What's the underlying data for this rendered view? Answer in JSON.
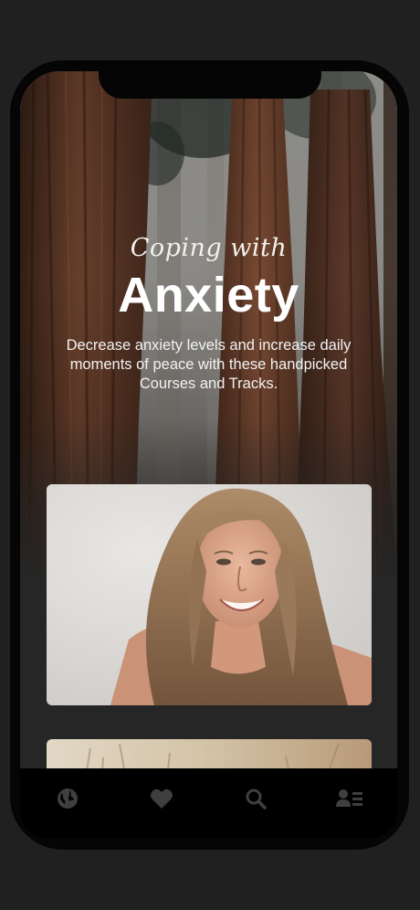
{
  "hero": {
    "eyebrow": "Coping with",
    "title": "Anxiety",
    "description": "Decrease anxiety levels and increase daily moments of peace with these handpicked Courses and Tracks."
  },
  "cards": [
    {
      "image": "portrait-smiling-woman-photo"
    },
    {
      "image": "grass-field-photo"
    }
  ],
  "tabbar": {
    "items": [
      {
        "icon": "globe-icon"
      },
      {
        "icon": "heart-icon"
      },
      {
        "icon": "search-icon"
      },
      {
        "icon": "profile-list-icon"
      }
    ],
    "icon_color": "#3f3f3f"
  },
  "colors": {
    "background": "#202020",
    "device": "#050505",
    "screen": "#262626",
    "text": "#ffffff"
  }
}
